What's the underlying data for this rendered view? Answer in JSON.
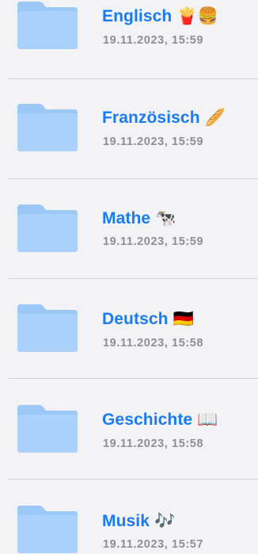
{
  "colors": {
    "background": "#f2f2f7",
    "folder_front": "#a9d1fb",
    "folder_back": "#9cc8f7",
    "name_text": "#1a7cf5",
    "date_text": "#8e8e93",
    "divider": "#d1d1d6"
  },
  "folders": [
    {
      "name": "Englisch 🍟🍔",
      "date": "19.11.2023, 15:59",
      "icon": "folder-icon"
    },
    {
      "name": "Französisch 🥖",
      "date": "19.11.2023, 15:59",
      "icon": "folder-icon"
    },
    {
      "name": "Mathe 🐄",
      "date": "19.11.2023, 15:59",
      "icon": "folder-icon"
    },
    {
      "name": "Deutsch 🇩🇪",
      "date": "19.11.2023, 15:58",
      "icon": "folder-icon"
    },
    {
      "name": "Geschichte 📖",
      "date": "19.11.2023, 15:58",
      "icon": "folder-icon"
    },
    {
      "name": "Musik 🎶",
      "date": "19.11.2023, 15:57",
      "icon": "folder-icon"
    }
  ]
}
